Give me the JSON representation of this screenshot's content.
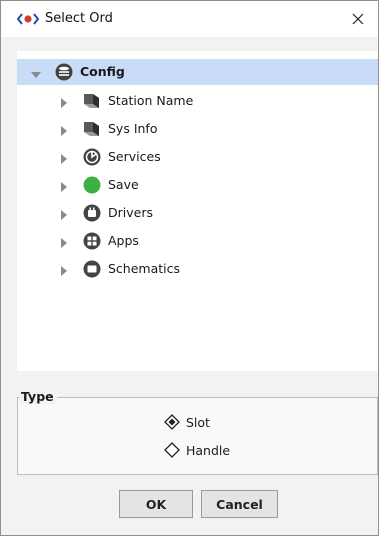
{
  "window": {
    "title": "Select Ord"
  },
  "tree": {
    "root": {
      "label": "Config",
      "icon": "database-icon",
      "expanded": true,
      "selected": true
    },
    "children": [
      {
        "label": "Station Name",
        "icon": "component-icon"
      },
      {
        "label": "Sys Info",
        "icon": "component-icon"
      },
      {
        "label": "Services",
        "icon": "services-icon"
      },
      {
        "label": "Save",
        "icon": "green-circle-icon"
      },
      {
        "label": "Drivers",
        "icon": "drivers-icon"
      },
      {
        "label": "Apps",
        "icon": "apps-icon"
      },
      {
        "label": "Schematics",
        "icon": "schematics-icon"
      }
    ]
  },
  "type": {
    "legend": "Type",
    "options": [
      {
        "label": "Slot",
        "selected": true
      },
      {
        "label": "Handle",
        "selected": false
      }
    ]
  },
  "buttons": {
    "ok": "OK",
    "cancel": "Cancel"
  },
  "colors": {
    "selection": "#c9dcf7",
    "save_green": "#3cb043",
    "icon_dark": "#4a4a4a"
  }
}
